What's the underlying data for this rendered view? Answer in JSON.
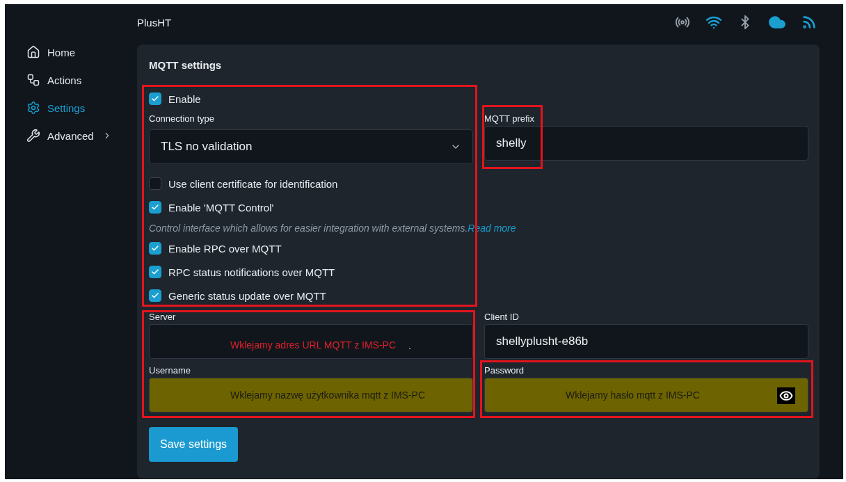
{
  "header": {
    "title": "PlusHT",
    "status_icons": [
      {
        "kind": "radio",
        "on": false
      },
      {
        "kind": "wifi",
        "on": true
      },
      {
        "kind": "bluetooth",
        "on": false
      },
      {
        "kind": "cloud",
        "on": true
      },
      {
        "kind": "mqtt",
        "on": true
      }
    ]
  },
  "sidebar": {
    "items": [
      {
        "kind": "home",
        "label": "Home",
        "selected": false
      },
      {
        "kind": "actions",
        "label": "Actions",
        "selected": false
      },
      {
        "kind": "settings",
        "label": "Settings",
        "selected": true
      },
      {
        "kind": "advanced",
        "label": "Advanced",
        "selected": false,
        "expandable": true
      }
    ]
  },
  "panel": {
    "title": "MQTT settings",
    "left_items": [
      {
        "kind": "checkbox",
        "label": "Enable",
        "checked": true
      },
      {
        "kind": "select",
        "label": "Connection type",
        "value": "TLS no validation"
      },
      {
        "kind": "checkbox",
        "label": "Use client certificate for identification",
        "checked": false
      },
      {
        "kind": "checkbox",
        "label": "Enable 'MQTT Control'",
        "checked": true
      },
      {
        "kind": "hint",
        "text": "Control interface which allows for easier integration with external systems.",
        "link": "Read more"
      },
      {
        "kind": "checkbox",
        "label": "Enable RPC over MQTT",
        "checked": true
      },
      {
        "kind": "checkbox",
        "label": "RPC status notifications over MQTT",
        "checked": true
      },
      {
        "kind": "checkbox",
        "label": "Generic status update over MQTT",
        "checked": true
      }
    ],
    "prefix": {
      "label": "MQTT prefix",
      "value": "shelly"
    },
    "fields": [
      {
        "label": "Server",
        "kind": "red_note",
        "value": "Wklejamy adres URL MQTT z IMS-PC",
        "mark": "."
      },
      {
        "label": "Client ID",
        "kind": "plain",
        "value": "shellyplusht-e86b"
      },
      {
        "label": "Username",
        "kind": "olive_note",
        "value": "Wklejamy nazwę użytkownika mqtt z IMS-PC"
      },
      {
        "label": "Password",
        "kind": "olive_note",
        "value": "Wklejamy hasło mqtt z IMS-PC",
        "reveal": true
      }
    ],
    "save_button": "Save settings"
  }
}
